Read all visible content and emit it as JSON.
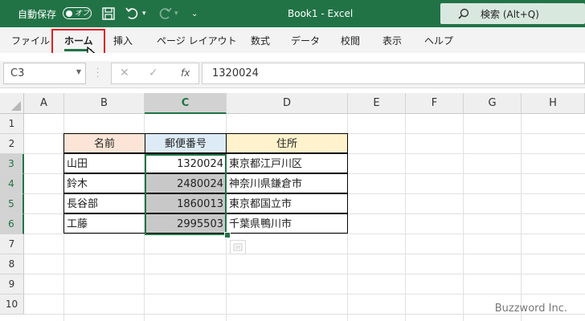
{
  "titlebar": {
    "autosave_label": "自動保存",
    "autosave_state": "オフ",
    "title": "Book1 - Excel",
    "search_label": "検索 (Alt+Q)"
  },
  "ribbon": {
    "tabs": [
      "ファイル",
      "ホーム",
      "挿入",
      "ページ レイアウト",
      "数式",
      "データ",
      "校閲",
      "表示",
      "ヘルプ"
    ],
    "active_tab": "ホーム"
  },
  "formula_bar": {
    "name_box": "C3",
    "fx": "fx",
    "value": "1320024"
  },
  "grid": {
    "columns": [
      "A",
      "B",
      "C",
      "D",
      "E",
      "F",
      "G",
      "H"
    ],
    "selected_column": "C",
    "rows": [
      "1",
      "2",
      "3",
      "4",
      "5",
      "6",
      "7",
      "8",
      "9",
      "10"
    ],
    "selected_rows": [
      "3",
      "4",
      "5",
      "6"
    ]
  },
  "table": {
    "headers": [
      "名前",
      "郵便番号",
      "住所"
    ],
    "header_colors": [
      "#fce4d6",
      "#ddebf7",
      "#fff2cc"
    ],
    "rows": [
      [
        "山田",
        "1320024",
        "東京都江戸川区"
      ],
      [
        "鈴木",
        "2480024",
        "神奈川県鎌倉市"
      ],
      [
        "長谷部",
        "1860013",
        "東京都国立市"
      ],
      [
        "工藤",
        "2995503",
        "千葉県鴨川市"
      ]
    ],
    "selected_fill": "#c8c8c8"
  },
  "watermark": "Buzzword Inc.",
  "colors": {
    "brand": "#217346",
    "highlight_box": "#e02020"
  }
}
